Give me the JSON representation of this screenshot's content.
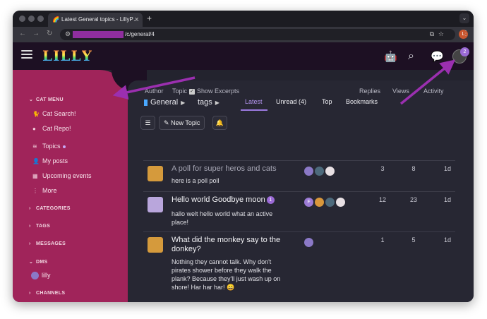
{
  "browser": {
    "tab_title": "Latest General topics - LillyP…",
    "url_visible": "/c/general/4",
    "profile_initial": "L"
  },
  "header": {
    "logo_letters": [
      "L",
      "I",
      "L",
      "L",
      "Y"
    ],
    "user_badge": "2"
  },
  "sidebar": {
    "cat_menu": "CAT MENU",
    "cat_search": "Cat Search!",
    "cat_repo": "Cat Repo!",
    "topics": "Topics",
    "my_posts": "My posts",
    "upcoming": "Upcoming events",
    "more": "More",
    "categories": "CATEGORIES",
    "tags": "TAGS",
    "messages": "MESSAGES",
    "dms": "DMS",
    "dm_user": "lilly",
    "channels": "CHANNELS"
  },
  "main": {
    "crumb_category": "General",
    "crumb_tags": "tags",
    "tabs": [
      "Latest",
      "Unread (4)",
      "Top",
      "Bookmarks"
    ],
    "new_topic": "New Topic",
    "columns": {
      "author": "Author",
      "topic": "Topic",
      "excerpts": "Show Excerpts",
      "replies": "Replies",
      "views": "Views",
      "activity": "Activity"
    },
    "topics": [
      {
        "title": "A poll for super heros and cats",
        "excerpt": "here is a poll poll",
        "replies": "3",
        "views": "8",
        "activity": "1d",
        "read": true
      },
      {
        "title": "Hello world Goodbye moon",
        "count": "1",
        "excerpt": "hallo welt hello world what an active place!",
        "replies": "12",
        "views": "23",
        "activity": "1d",
        "read": false,
        "poster_initial": "F"
      },
      {
        "title": "What did the monkey say to the donkey?",
        "excerpt": "Nothing they cannot talk. Why don't pirates shower before they walk the plank? Because they'll just wash up on shore! Har har har! 😄",
        "replies": "1",
        "views": "5",
        "activity": "1d",
        "read": false
      }
    ]
  },
  "colors": {
    "sidebar": "#a0245a",
    "accent": "#9b7ae0",
    "arrow": "#9b2fb0"
  }
}
